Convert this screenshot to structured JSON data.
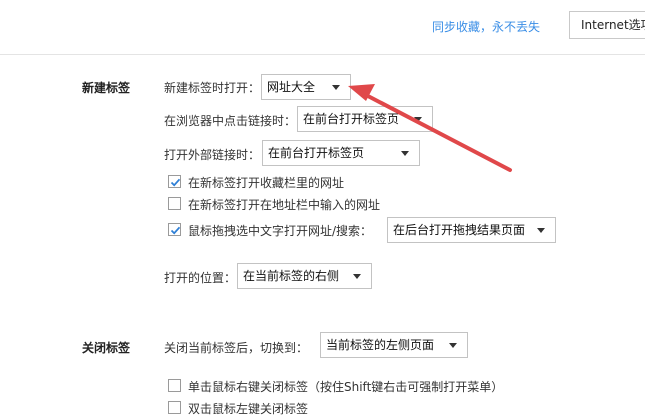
{
  "header": {
    "sync_text": "同步收藏，永不丢失",
    "ie_button_label": "Internet选项"
  },
  "new_tab_section": {
    "title": "新建标签",
    "open_new_tab_label": "新建标签时打开：",
    "open_new_tab_value": "网址大全",
    "click_link_label": "在浏览器中点击链接时：",
    "click_link_value": "在前台打开标签页",
    "external_link_label": "打开外部链接时：",
    "external_link_value": "在前台打开标签页",
    "checkboxes": [
      {
        "label": "在新标签打开收藏栏里的网址",
        "checked": true
      },
      {
        "label": "在新标签打开在地址栏中输入的网址",
        "checked": false
      },
      {
        "label": "鼠标拖拽选中文字打开网址/搜索：",
        "checked": true
      }
    ],
    "drag_select_value": "在后台打开拖拽结果页面",
    "position_label": "打开的位置：",
    "position_value": "在当前标签的右侧"
  },
  "close_tab_section": {
    "title": "关闭标签",
    "switch_label": "关闭当前标签后，切换到：",
    "switch_value": "当前标签的左侧页面",
    "checkboxes": [
      {
        "label": "单击鼠标右键关闭标签（按住Shift键右击可强制打开菜单）",
        "checked": false
      },
      {
        "label": "双击鼠标左键关闭标签",
        "checked": false
      }
    ]
  },
  "annotation": {
    "arrow_color": "#e0484a"
  }
}
